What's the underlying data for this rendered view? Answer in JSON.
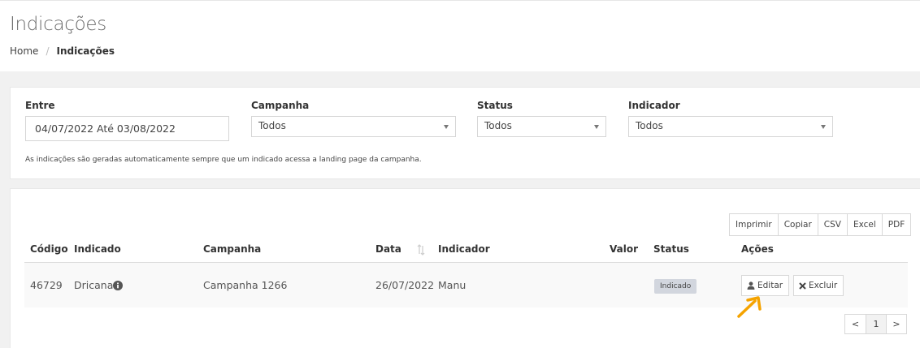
{
  "page": {
    "title": "Indicações",
    "breadcrumb": {
      "home": "Home",
      "separator": "/",
      "current": "Indicações"
    }
  },
  "filters": {
    "entre": {
      "label": "Entre",
      "value": "04/07/2022 Até 03/08/2022"
    },
    "campanha": {
      "label": "Campanha",
      "value": "Todos"
    },
    "status": {
      "label": "Status",
      "value": "Todos"
    },
    "indicador": {
      "label": "Indicador",
      "value": "Todos"
    },
    "note": "As indicações são geradas automaticamente sempre que um indicado acessa a landing page da campanha."
  },
  "export_buttons": [
    "Imprimir",
    "Copiar",
    "CSV",
    "Excel",
    "PDF"
  ],
  "table": {
    "columns": {
      "codigo": "Código",
      "indicado": "Indicado",
      "campanha": "Campanha",
      "data": "Data",
      "indicador": "Indicador",
      "valor": "Valor",
      "status": "Status",
      "acoes": "Ações"
    },
    "rows": [
      {
        "codigo": "46729",
        "indicado": "Dricana",
        "campanha": "Campanha 1266",
        "data": "26/07/2022",
        "indicador": "Manu",
        "valor": "",
        "status": "Indicado",
        "edit_label": "Editar",
        "delete_label": "Excluir"
      }
    ]
  },
  "pagination": {
    "prev": "<",
    "current": "1",
    "next": ">"
  },
  "colors": {
    "annotation_arrow": "#f5a300",
    "badge_bg": "#d2d6de",
    "row_bg": "#f9f9f9"
  },
  "icons": {
    "info": "info-circle-icon",
    "edit": "user-icon",
    "delete": "times-icon",
    "sort": "sort-icon"
  }
}
